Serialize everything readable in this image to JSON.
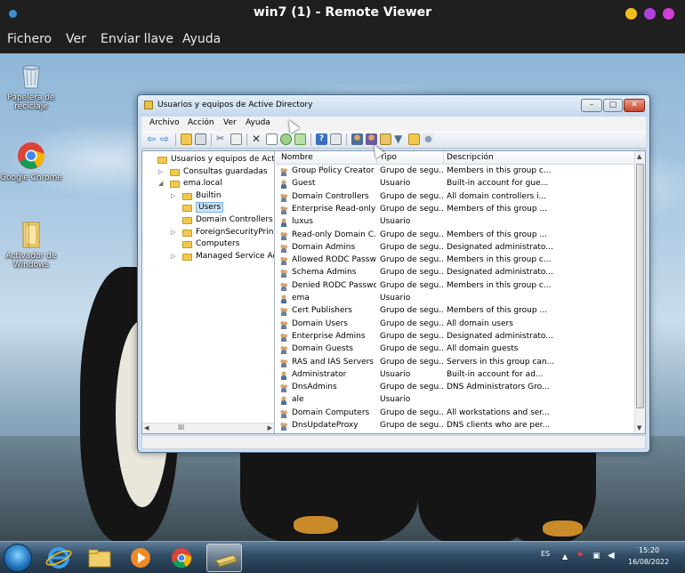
{
  "viewer": {
    "title": "win7 (1) - Remote Viewer",
    "menu": [
      "Fichero",
      "Ver",
      "Enviar llave",
      "Ayuda"
    ],
    "window_buttons": [
      "#f2c01c",
      "#b23fe0",
      "#d23fd8"
    ]
  },
  "desktop": {
    "icons": [
      {
        "label": "Papelera de reciclaje",
        "icon": "recycle-bin-icon"
      },
      {
        "label": "Google Chrome",
        "icon": "chrome-icon"
      },
      {
        "label": "Activador de Windows",
        "icon": "folder-icon"
      }
    ]
  },
  "ad": {
    "title": "Usuarios y equipos de Active Directory",
    "menu": [
      "Archivo",
      "Acción",
      "Ver",
      "Ayuda"
    ],
    "tree": [
      {
        "label": "Usuarios y equipos de Active Directory",
        "level": 0,
        "arrow": ""
      },
      {
        "label": "Consultas guardadas",
        "level": 1,
        "arrow": "▷"
      },
      {
        "label": "ema.local",
        "level": 1,
        "arrow": "◢"
      },
      {
        "label": "Builtin",
        "level": 2,
        "arrow": "▷"
      },
      {
        "label": "Users",
        "level": 2,
        "arrow": "",
        "selected": true
      },
      {
        "label": "Domain Controllers",
        "level": 2,
        "arrow": ""
      },
      {
        "label": "ForeignSecurityPrincipals",
        "level": 2,
        "arrow": "▷"
      },
      {
        "label": "Computers",
        "level": 2,
        "arrow": ""
      },
      {
        "label": "Managed Service Accounts",
        "level": 2,
        "arrow": "▷"
      }
    ],
    "columns": [
      "Nombre",
      "Tipo",
      "Descripción"
    ],
    "rows": [
      [
        "Group Policy Creator ...",
        "Grupo de segu...",
        "Members in this group c..."
      ],
      [
        "Guest",
        "Usuario",
        "Built-in account for gue..."
      ],
      [
        "Domain Controllers",
        "Grupo de segu...",
        "All domain controllers i..."
      ],
      [
        "Enterprise Read-only ...",
        "Grupo de segu...",
        "Members of this group ..."
      ],
      [
        "luxus",
        "Usuario",
        ""
      ],
      [
        "Read-only Domain C...",
        "Grupo de segu...",
        "Members of this group ..."
      ],
      [
        "Domain Admins",
        "Grupo de segu...",
        "Designated administrato..."
      ],
      [
        "Allowed RODC Passw...",
        "Grupo de segu...",
        "Members in this group c..."
      ],
      [
        "Schema Admins",
        "Grupo de segu...",
        "Designated administrato..."
      ],
      [
        "Denied RODC Passwo...",
        "Grupo de segu...",
        "Members in this group c..."
      ],
      [
        "ema",
        "Usuario",
        ""
      ],
      [
        "Cert Publishers",
        "Grupo de segu...",
        "Members of this group ..."
      ],
      [
        "Domain Users",
        "Grupo de segu...",
        "All domain users"
      ],
      [
        "Enterprise Admins",
        "Grupo de segu...",
        "Designated administrato..."
      ],
      [
        "Domain Guests",
        "Grupo de segu...",
        "All domain guests"
      ],
      [
        "RAS and IAS Servers",
        "Grupo de segu...",
        "Servers in this group can..."
      ],
      [
        "Administrator",
        "Usuario",
        "Built-in account for ad..."
      ],
      [
        "DnsAdmins",
        "Grupo de segu...",
        "DNS Administrators Gro..."
      ],
      [
        "ale",
        "Usuario",
        ""
      ],
      [
        "Domain Computers",
        "Grupo de segu...",
        "All workstations and ser..."
      ],
      [
        "DnsUpdateProxy",
        "Grupo de segu...",
        "DNS clients who are per..."
      ]
    ],
    "tree_scroll_label": "III"
  },
  "taskbar": {
    "lang": "ES",
    "time": "15:20",
    "date": "16/08/2022"
  }
}
